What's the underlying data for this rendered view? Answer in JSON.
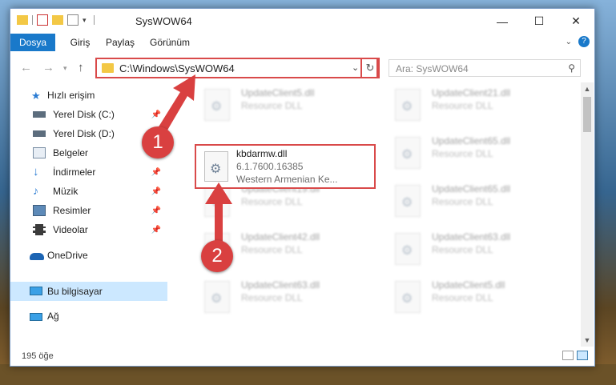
{
  "window": {
    "title": "SysWOW64",
    "minimize_glyph": "—",
    "maximize_glyph": "☐",
    "close_glyph": "✕"
  },
  "ribbon": {
    "tabs": [
      "Dosya",
      "Giriş",
      "Paylaş",
      "Görünüm"
    ]
  },
  "address": {
    "path": "C:\\Windows\\SysWOW64",
    "refresh_glyph": "↻"
  },
  "search": {
    "placeholder": "Ara: SysWOW64"
  },
  "nav": {
    "items": [
      {
        "label": "Hızlı erişim",
        "icon": "star-icon",
        "pinned": false
      },
      {
        "label": "Yerel Disk (C:)",
        "icon": "drive-icon",
        "pinned": true
      },
      {
        "label": "Yerel Disk (D:)",
        "icon": "drive-icon",
        "pinned": false
      },
      {
        "label": "Belgeler",
        "icon": "documents-icon",
        "pinned": true
      },
      {
        "label": "İndirmeler",
        "icon": "download-icon",
        "pinned": true
      },
      {
        "label": "Müzik",
        "icon": "music-icon",
        "pinned": true
      },
      {
        "label": "Resimler",
        "icon": "pictures-icon",
        "pinned": true
      },
      {
        "label": "Videolar",
        "icon": "videos-icon",
        "pinned": true
      },
      {
        "label": "OneDrive",
        "icon": "cloud-icon",
        "pinned": false
      },
      {
        "label": "Bu bilgisayar",
        "icon": "computer-icon",
        "pinned": false,
        "selected": true
      },
      {
        "label": "Ağ",
        "icon": "network-icon",
        "pinned": false
      }
    ]
  },
  "files": [
    {
      "name": "UpdateClient5.dll",
      "type": "Resource DLL"
    },
    {
      "name": "UpdateClient21.dll",
      "type": "Resource DLL"
    },
    {
      "name": "UpdateClient65.dll",
      "type": "Resource DLL"
    },
    {
      "name": "UpdateClient19.dll",
      "type": "Resource DLL"
    },
    {
      "name": "UpdateClient65.dll",
      "type": "Resource DLL"
    },
    {
      "name": "UpdateClient42.dll",
      "type": "Resource DLL"
    },
    {
      "name": "UpdateClient63.dll",
      "type": "Resource DLL"
    },
    {
      "name": "UpdateClient63.dll",
      "type": "Resource DLL"
    },
    {
      "name": "UpdateClient5.dll",
      "type": "Resource DLL"
    }
  ],
  "highlighted_file": {
    "name": "kbdarmw.dll",
    "version": "6.1.7600.16385",
    "description": "Western Armenian Ke..."
  },
  "status": {
    "item_count": "195 öğe"
  },
  "callouts": [
    "1",
    "2"
  ],
  "colors": {
    "accent": "#1979ca",
    "highlight": "#d94a4a",
    "callout": "#d94040",
    "selected": "#cce8ff"
  }
}
